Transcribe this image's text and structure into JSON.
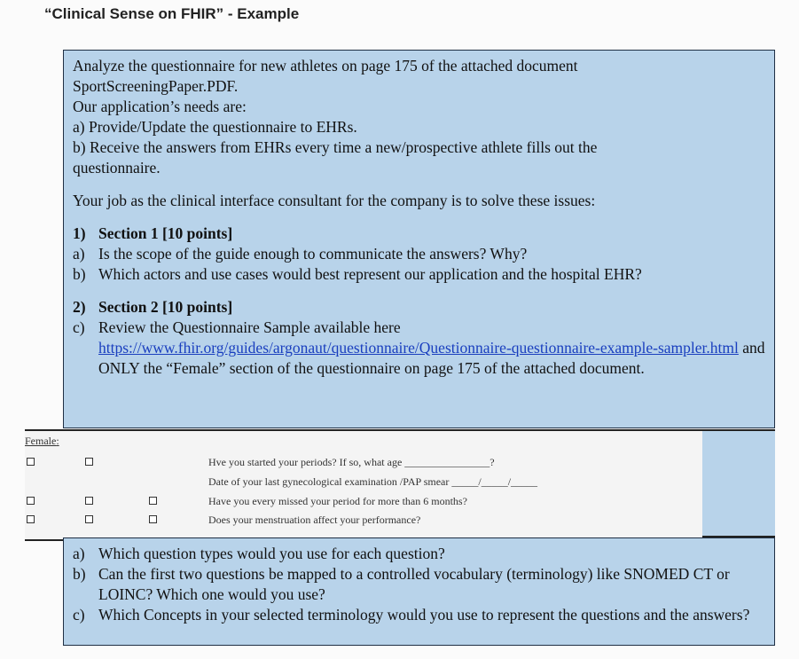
{
  "title": "“Clinical Sense on FHIR” - Example",
  "top_box": {
    "intro": [
      "Analyze the questionnaire for new athletes on page 175 of the attached document",
      "SportScreeningPaper.PDF.",
      "Our application’s needs are:",
      " a) Provide/Update the questionnaire to EHRs.",
      "b) Receive the answers from EHRs every time a new/prospective athlete fills out the",
      "questionnaire."
    ],
    "job": "Your job as the clinical interface consultant for the company is to solve these issues:",
    "section1": {
      "marker": "1)",
      "heading": "Section 1 [10 points]",
      "items": [
        {
          "marker": "a)",
          "text": "Is the scope of the guide enough to communicate the answers? Why?"
        },
        {
          "marker": "b)",
          "text": "Which actors and use cases would best represent our application and the hospital EHR?"
        }
      ]
    },
    "section2": {
      "marker": "2)",
      "heading": "Section 2 [10 points]",
      "item_marker": "c)",
      "line1": "Review the Questionnaire Sample available here",
      "link": "https://www.fhir.org/guides/argonaut/questionnaire/Questionnaire-questionnaire-example-sampler.html",
      "after_link": " and ONLY the “Female” section of the questionnaire on page 175 of the attached document."
    }
  },
  "female_section": {
    "label": "Female",
    "colon": ":",
    "questions": [
      "Hve you started your periods? If so, what age ________________?",
      "Date of your last gynecological examination /PAP smear _____/_____/_____",
      "Have you every missed your period for more than 6 months?",
      "Does your menstruation affect your performance?"
    ]
  },
  "bottom_box": {
    "items": [
      {
        "marker": "a)",
        "text": "Which question types would you use for each question?"
      },
      {
        "marker": "b)",
        "text": "Can the first two questions be mapped to a controlled vocabulary (terminology) like SNOMED CT or LOINC? Which one would you use?"
      },
      {
        "marker": "c)",
        "text": "Which Concepts in your selected terminology would you use to represent the questions and the answers?"
      }
    ]
  }
}
